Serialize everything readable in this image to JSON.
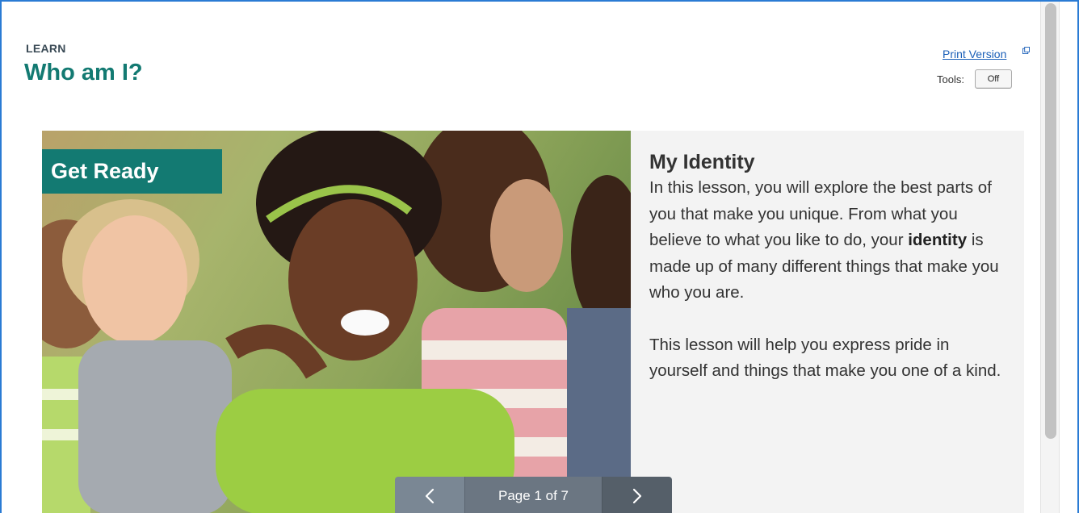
{
  "header": {
    "section_label": "LEARN",
    "title": "Who am I?",
    "print_link": "Print Version",
    "tools_label": "Tools:",
    "tools_toggle": "Off"
  },
  "lesson": {
    "badge": "Get Ready",
    "heading": "My Identity",
    "paragraph1_before": "In this lesson, you will explore the best parts of you that make you unique. From what you believe to what you like to do, your ",
    "paragraph1_bold": "identity",
    "paragraph1_after": " is made up of many different things that make you who you are.",
    "paragraph2": "This lesson will help you express pride in yourself and things that make you one of a kind."
  },
  "pager": {
    "label": "Page 1 of 7"
  },
  "colors": {
    "brand_teal": "#137a72",
    "link_blue": "#1a5fb8",
    "frame_blue": "#2a7bd4",
    "pager_gray": "#6b7682"
  },
  "icons": {
    "prev": "chevron-left-icon",
    "next": "chevron-right-icon",
    "external": "external-link-icon"
  }
}
